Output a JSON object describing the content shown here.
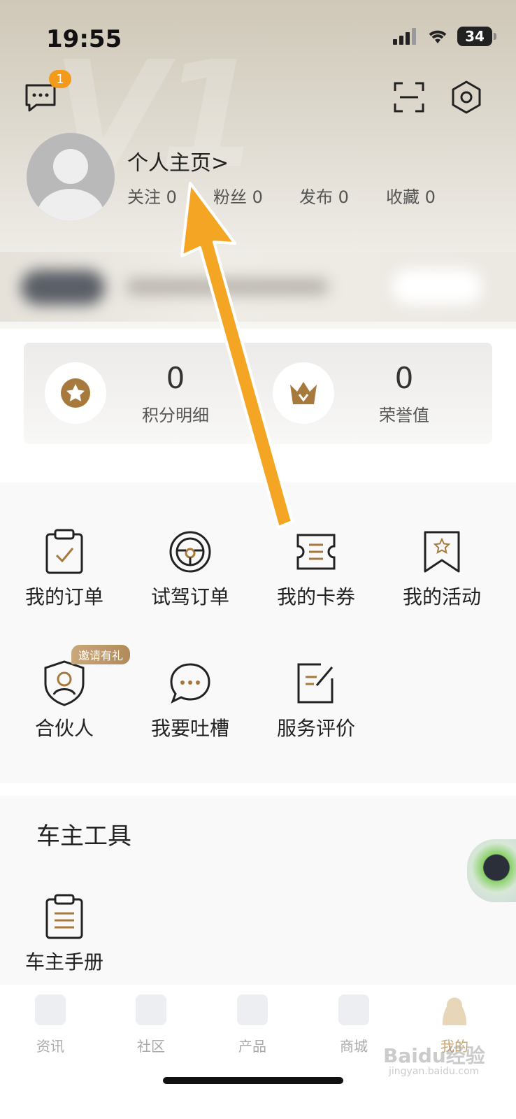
{
  "status_bar": {
    "time": "19:55",
    "battery": "34"
  },
  "header": {
    "brand_mark": "V1",
    "message_badge": "1",
    "profile_link": "个人主页>",
    "stats": [
      {
        "label": "关注",
        "value": "0"
      },
      {
        "label": "粉丝",
        "value": "0"
      },
      {
        "label": "发布",
        "value": "0"
      },
      {
        "label": "收藏",
        "value": "0"
      }
    ]
  },
  "points": {
    "items": [
      {
        "value": "0",
        "label": "积分明细",
        "icon": "star-medal-icon"
      },
      {
        "value": "0",
        "label": "荣誉值",
        "icon": "crown-icon"
      }
    ]
  },
  "menu": {
    "row1": [
      {
        "label": "我的订单",
        "icon": "clipboard-check-icon"
      },
      {
        "label": "试驾订单",
        "icon": "steering-wheel-icon"
      },
      {
        "label": "我的卡券",
        "icon": "ticket-icon"
      },
      {
        "label": "我的活动",
        "icon": "bookmark-star-icon"
      }
    ],
    "row2": [
      {
        "label": "合伙人",
        "icon": "shield-partner-icon",
        "badge": "邀请有礼"
      },
      {
        "label": "我要吐槽",
        "icon": "chat-bubble-icon"
      },
      {
        "label": "服务评价",
        "icon": "edit-note-icon"
      }
    ]
  },
  "tools": {
    "title": "车主工具",
    "items": [
      {
        "label": "车主手册",
        "icon": "manual-icon"
      }
    ]
  },
  "tabbar": {
    "tabs": [
      {
        "label": "资讯",
        "active": false
      },
      {
        "label": "社区",
        "active": false
      },
      {
        "label": "产品",
        "active": false
      },
      {
        "label": "商城",
        "active": false
      },
      {
        "label": "我的",
        "active": true
      }
    ]
  },
  "watermark": {
    "text": "Baidu经验",
    "sub": "jingyan.baidu.com"
  },
  "colors": {
    "accent": "#f39a1c",
    "gold": "#a8793c",
    "arrow": "#f5a524"
  }
}
